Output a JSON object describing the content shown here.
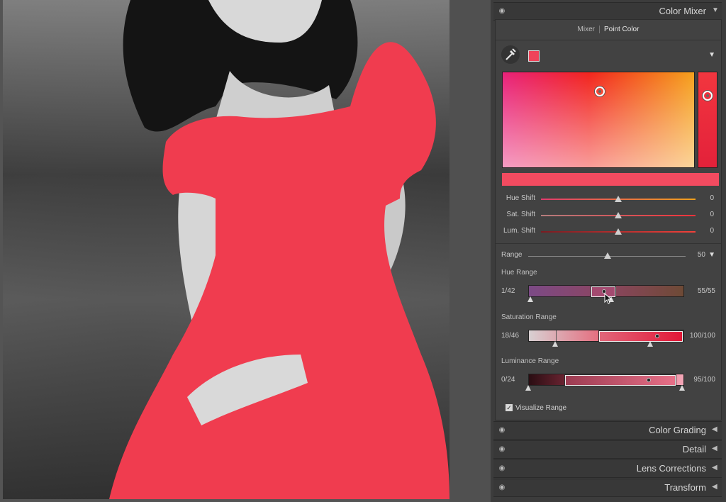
{
  "panel": {
    "color_mixer": {
      "title": "Color Mixer",
      "tabs": [
        "Mixer",
        "Point Color"
      ],
      "active_tab": "Point Color",
      "sampled_color": "#f0445a",
      "hue_shift": {
        "label": "Hue Shift",
        "value": "0"
      },
      "sat_shift": {
        "label": "Sat. Shift",
        "value": "0"
      },
      "lum_shift": {
        "label": "Lum. Shift",
        "value": "0"
      },
      "range": {
        "label": "Range",
        "value": "50"
      },
      "hue_range": {
        "label": "Hue Range",
        "left": "1/42",
        "right": "55/55"
      },
      "saturation_range": {
        "label": "Saturation Range",
        "left": "18/46",
        "right": "100/100"
      },
      "luminance_range": {
        "label": "Luminance Range",
        "left": "0/24",
        "right": "95/100"
      },
      "visualize_range": {
        "label": "Visualize Range",
        "checked": true
      }
    },
    "sections": [
      {
        "title": "Color Grading"
      },
      {
        "title": "Detail"
      },
      {
        "title": "Lens Corrections"
      },
      {
        "title": "Transform"
      }
    ]
  },
  "colors": {
    "accent_red": "#f24b60",
    "panel_bg": "#3c3c3c"
  }
}
